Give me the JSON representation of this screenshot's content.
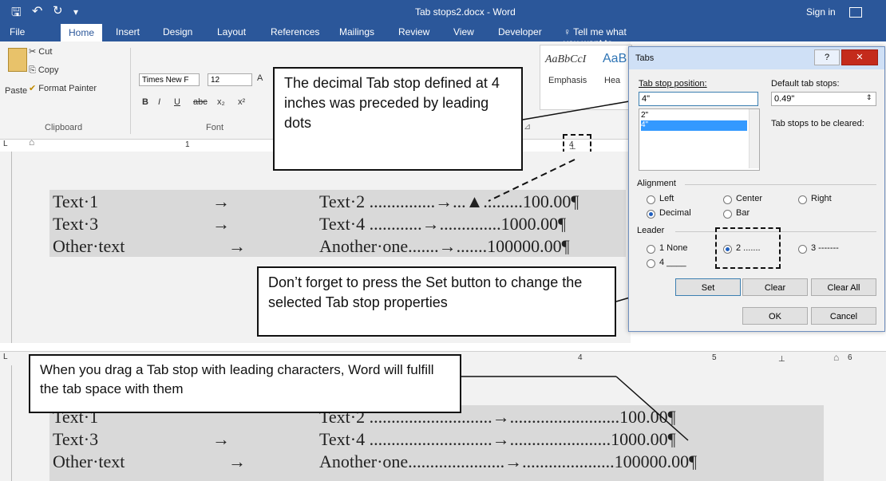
{
  "app": {
    "title": "Tab stops2.docx  -  Word",
    "sign_in": "Sign in",
    "qat": {
      "save": "🖫",
      "undo": "↶",
      "redo": "↻",
      "more": "▾"
    }
  },
  "ribbon": {
    "tabs": [
      "File",
      "Home",
      "Insert",
      "Design",
      "Layout",
      "References",
      "Mailings",
      "Review",
      "View",
      "Developer"
    ],
    "active_tab": "Home",
    "tell_me": "Tell me what you want to do...",
    "clipboard": {
      "paste": "Paste",
      "cut": "Cut",
      "copy": "Copy",
      "format_painter": "Format Painter",
      "group": "Clipboard"
    },
    "font": {
      "name": "Times New F",
      "size": "12",
      "group": "Font",
      "bold": "B",
      "italic": "I",
      "underline": "U",
      "strike": "abc",
      "sub": "x₂",
      "sup": "x²"
    },
    "styles": [
      {
        "preview": "AaBbCcI",
        "name": "Emphasis"
      },
      {
        "preview": "AaB",
        "name": "Hea"
      }
    ],
    "styles_group_launcher": "⊿"
  },
  "rulers": {
    "top_marks": [
      "1",
      "4"
    ],
    "bottom_marks": [
      "4",
      "5",
      "6"
    ]
  },
  "document_top": {
    "rows": [
      {
        "c1": "Text·1",
        "c2": "Text·2 ...............→...▲.........100.00¶"
      },
      {
        "c1": "Text·3",
        "c2": "Text·4 ............→..............1000.00¶"
      },
      {
        "c1": "Other·text",
        "c2": "Another·one.......→.......100000.00¶"
      }
    ],
    "tab_arrow": "→"
  },
  "document_bottom": {
    "rows": [
      {
        "c1": "Text·1",
        "c2": "Text·2 ............................→.........................100.00¶"
      },
      {
        "c1": "Text·3",
        "c2": "Text·4 ............................→.......................1000.00¶"
      },
      {
        "c1": "Other·text",
        "c2": "Another·one......................→.....................100000.00¶"
      }
    ],
    "tab_arrow": "→"
  },
  "callouts": {
    "top": "The decimal Tab stop defined at 4 inches was preceded by leading dots",
    "middle": "Don’t forget to press the Set button to change the selected Tab stop properties",
    "bottom": "When you drag a Tab stop with leading characters, Word will fulfill the tab space with them"
  },
  "dialog": {
    "title": "Tabs",
    "help": "?",
    "close": "✕",
    "tab_stop_position_label": "Tab stop position:",
    "tab_stop_position_value": "4\"",
    "positions_list": [
      "2\"",
      "4\""
    ],
    "default_tab_stops_label": "Default tab stops:",
    "default_tab_stops_value": "0.49\"",
    "tab_stops_cleared_label": "Tab stops to be cleared:",
    "alignment_label": "Alignment",
    "alignment": [
      {
        "label": "Left",
        "selected": false
      },
      {
        "label": "Center",
        "selected": false
      },
      {
        "label": "Right",
        "selected": false
      },
      {
        "label": "Decimal",
        "selected": true
      },
      {
        "label": "Bar",
        "selected": false
      }
    ],
    "leader_label": "Leader",
    "leader": [
      {
        "label": "1 None",
        "selected": false
      },
      {
        "label": "2 .......",
        "selected": true
      },
      {
        "label": "3 -------",
        "selected": false
      },
      {
        "label": "4 ____",
        "selected": false
      }
    ],
    "buttons": {
      "set": "Set",
      "clear": "Clear",
      "clear_all": "Clear All",
      "ok": "OK",
      "cancel": "Cancel"
    }
  }
}
